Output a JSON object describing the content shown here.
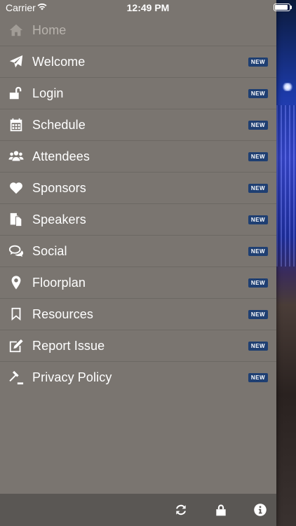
{
  "status_bar": {
    "carrier": "Carrier",
    "time": "12:49 PM"
  },
  "menu": {
    "items": [
      {
        "label": "Home",
        "icon": "home-icon",
        "badge": ""
      },
      {
        "label": "Welcome",
        "icon": "paper-plane-icon",
        "badge": "NEW"
      },
      {
        "label": "Login",
        "icon": "unlock-icon",
        "badge": "NEW"
      },
      {
        "label": "Schedule",
        "icon": "calendar-icon",
        "badge": "NEW"
      },
      {
        "label": "Attendees",
        "icon": "users-icon",
        "badge": "NEW"
      },
      {
        "label": "Sponsors",
        "icon": "heart-icon",
        "badge": "NEW"
      },
      {
        "label": "Speakers",
        "icon": "documents-icon",
        "badge": "NEW"
      },
      {
        "label": "Social",
        "icon": "chat-bubbles-icon",
        "badge": "NEW"
      },
      {
        "label": "Floorplan",
        "icon": "map-pin-icon",
        "badge": "NEW"
      },
      {
        "label": "Resources",
        "icon": "bookmark-icon",
        "badge": "NEW"
      },
      {
        "label": "Report Issue",
        "icon": "edit-icon",
        "badge": "NEW"
      },
      {
        "label": "Privacy Policy",
        "icon": "gavel-icon",
        "badge": "NEW"
      }
    ]
  },
  "bottom_bar": {
    "buttons": [
      {
        "icon": "refresh-icon"
      },
      {
        "icon": "lock-icon"
      },
      {
        "icon": "info-icon"
      }
    ]
  },
  "colors": {
    "drawer_bg": "#7a7570",
    "bottom_bar_bg": "#5a5754",
    "badge_bg": "#1f3f72",
    "text": "#ffffff"
  }
}
